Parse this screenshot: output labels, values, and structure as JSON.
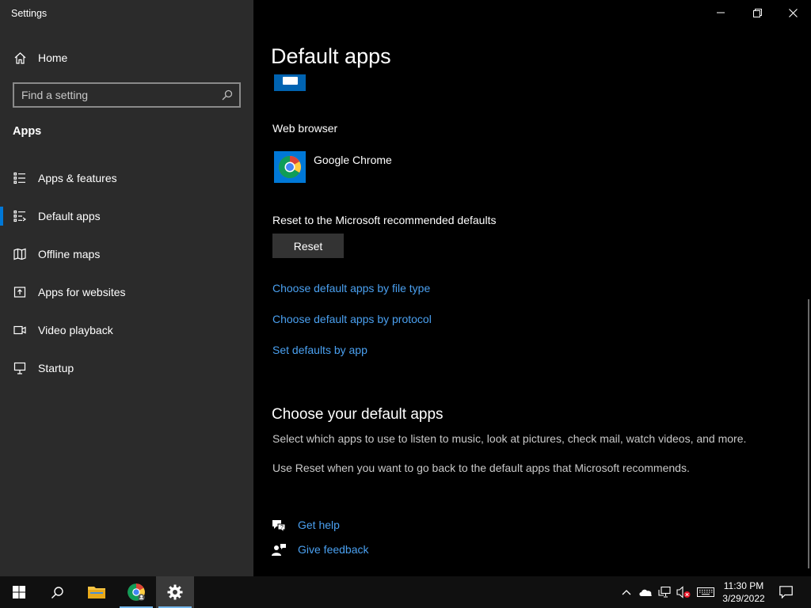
{
  "window": {
    "title": "Settings"
  },
  "sidebar": {
    "home_label": "Home",
    "search_placeholder": "Find a setting",
    "section_title": "Apps",
    "items": [
      {
        "label": "Apps & features",
        "icon": "list-icon",
        "active": false
      },
      {
        "label": "Default apps",
        "icon": "default-apps-icon",
        "active": true
      },
      {
        "label": "Offline maps",
        "icon": "map-icon",
        "active": false
      },
      {
        "label": "Apps for websites",
        "icon": "open-in-app-icon",
        "active": false
      },
      {
        "label": "Video playback",
        "icon": "video-icon",
        "active": false
      },
      {
        "label": "Startup",
        "icon": "startup-icon",
        "active": false
      }
    ]
  },
  "main": {
    "page_title": "Default apps",
    "web_browser_label": "Web browser",
    "web_browser_app": "Google Chrome",
    "reset_label": "Reset to the Microsoft recommended defaults",
    "reset_button": "Reset",
    "links": {
      "by_file_type": "Choose default apps by file type",
      "by_protocol": "Choose default apps by protocol",
      "by_app": "Set defaults by app"
    },
    "choose_title": "Choose your default apps",
    "desc1": "Select which apps to use to listen to music, look at pictures, check mail, watch videos, and more.",
    "desc2": "Use Reset when you want to go back to the default apps that Microsoft recommends.",
    "get_help": "Get help",
    "give_feedback": "Give feedback"
  },
  "taskbar": {
    "time": "11:30 PM",
    "date": "3/29/2022"
  },
  "colors": {
    "accent": "#0078d7",
    "link": "#4aa0f0",
    "sidebar_bg": "#2b2b2b"
  }
}
